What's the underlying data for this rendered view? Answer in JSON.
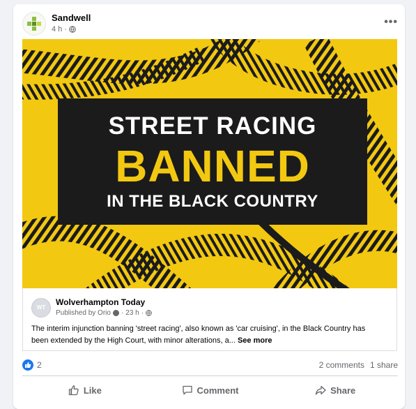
{
  "post": {
    "page_name": "Sandwell",
    "time": "4 h",
    "meta_separator": "·"
  },
  "banner": {
    "line1": "STREET RACING",
    "line2": "BANNED",
    "line3": "IN THE BLACK COUNTRY"
  },
  "link": {
    "source_name": "Wolverhampton Today",
    "published_by": "Published by Orio",
    "time": "23 h",
    "text": "The interim injunction banning 'street racing', also known as 'car cruising', in the Black Country has been extended by the High Court, with minor alterations, a...",
    "see_more": "See more",
    "logo_text": "WT"
  },
  "stats": {
    "reactions_count": "2",
    "comments": "2 comments",
    "shares": "1 share"
  },
  "actions": {
    "like": "Like",
    "comment": "Comment",
    "share": "Share"
  },
  "colors": {
    "yellow": "#f2c811",
    "black_banner": "#1b1b1b",
    "facebook_blue": "#1877f2",
    "muted_text": "#65676b"
  },
  "icons": [
    "more-options-icon",
    "globe-icon",
    "thumbs-up-icon",
    "comment-icon",
    "share-icon"
  ]
}
